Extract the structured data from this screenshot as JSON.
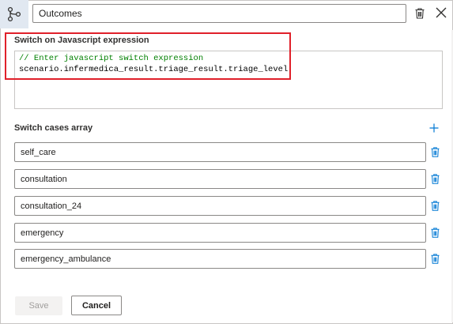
{
  "header": {
    "node_icon": "branch-icon",
    "title_value": "Outcomes",
    "delete_icon": "trash-icon",
    "close_icon": "close-icon"
  },
  "expression": {
    "label": "Switch on Javascript expression",
    "comment_line": "// Enter javascript switch expression",
    "code_line": "scenario.infermedica_result.triage_result.triage_level"
  },
  "cases": {
    "label": "Switch cases array",
    "add_icon": "plus-icon",
    "delete_icon": "trash-icon",
    "items": [
      {
        "value": "self_care"
      },
      {
        "value": "consultation"
      },
      {
        "value": "consultation_24"
      },
      {
        "value": "emergency"
      },
      {
        "value": "emergency_ambulance"
      }
    ]
  },
  "footer": {
    "save_label": "Save",
    "cancel_label": "Cancel"
  },
  "colors": {
    "accent": "#0078d4",
    "highlight": "#e0202a",
    "comment": "#008000"
  }
}
